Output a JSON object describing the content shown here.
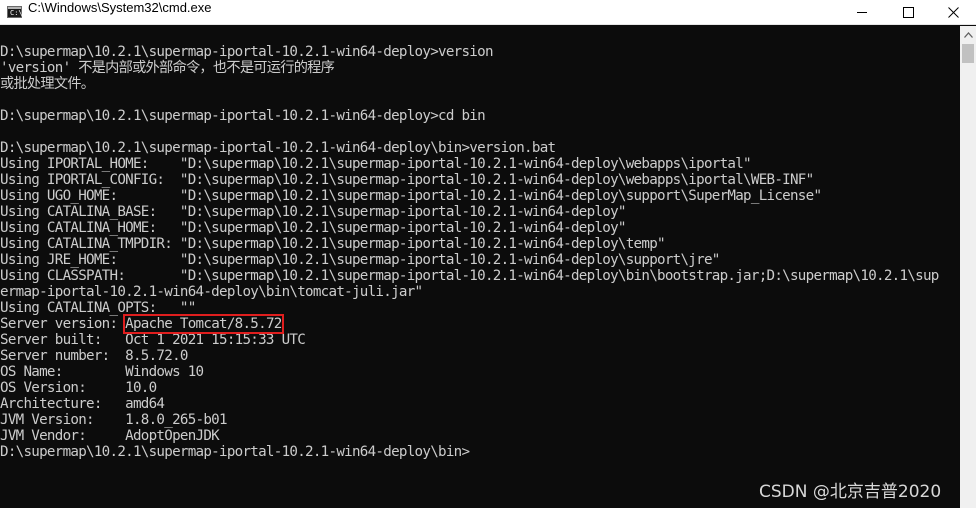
{
  "window": {
    "title": "C:\\Windows\\System32\\cmd.exe",
    "icon_glyph": "C:\\"
  },
  "console": {
    "lines": [
      "D:\\supermap\\10.2.1\\supermap-iportal-10.2.1-win64-deploy>version",
      "'version' 不是内部或外部命令，也不是可运行的程序",
      "或批处理文件。",
      "",
      "D:\\supermap\\10.2.1\\supermap-iportal-10.2.1-win64-deploy>cd bin",
      "",
      "D:\\supermap\\10.2.1\\supermap-iportal-10.2.1-win64-deploy\\bin>version.bat",
      "Using IPORTAL_HOME:    \"D:\\supermap\\10.2.1\\supermap-iportal-10.2.1-win64-deploy\\webapps\\iportal\"",
      "Using IPORTAL_CONFIG:  \"D:\\supermap\\10.2.1\\supermap-iportal-10.2.1-win64-deploy\\webapps\\iportal\\WEB-INF\"",
      "Using UGO_HOME:        \"D:\\supermap\\10.2.1\\supermap-iportal-10.2.1-win64-deploy\\support\\SuperMap_License\"",
      "Using CATALINA_BASE:   \"D:\\supermap\\10.2.1\\supermap-iportal-10.2.1-win64-deploy\"",
      "Using CATALINA_HOME:   \"D:\\supermap\\10.2.1\\supermap-iportal-10.2.1-win64-deploy\"",
      "Using CATALINA_TMPDIR: \"D:\\supermap\\10.2.1\\supermap-iportal-10.2.1-win64-deploy\\temp\"",
      "Using JRE_HOME:        \"D:\\supermap\\10.2.1\\supermap-iportal-10.2.1-win64-deploy\\support\\jre\"",
      "Using CLASSPATH:       \"D:\\supermap\\10.2.1\\supermap-iportal-10.2.1-win64-deploy\\bin\\bootstrap.jar;D:\\supermap\\10.2.1\\sup",
      "ermap-iportal-10.2.1-win64-deploy\\bin\\tomcat-juli.jar\"",
      "Using CATALINA_OPTS:   \"\"",
      {
        "prefix": "Server version: ",
        "highlight": "Apache Tomcat/8.5.72"
      },
      "Server built:   Oct 1 2021 15:15:33 UTC",
      "Server number:  8.5.72.0",
      "OS Name:        Windows 10",
      "OS Version:     10.0",
      "Architecture:   amd64",
      "JVM Version:    1.8.0_265-b01",
      "JVM Vendor:     AdoptOpenJDK",
      "D:\\supermap\\10.2.1\\supermap-iportal-10.2.1-win64-deploy\\bin>"
    ]
  },
  "controls": {
    "minimize_icon": "minimize-icon",
    "maximize_icon": "maximize-icon",
    "close_icon": "close-icon"
  },
  "watermark": "CSDN @北京吉普2020",
  "colors": {
    "background": "#0c0c0c",
    "text": "#cccccc",
    "highlight_box": "#e01e1e"
  }
}
